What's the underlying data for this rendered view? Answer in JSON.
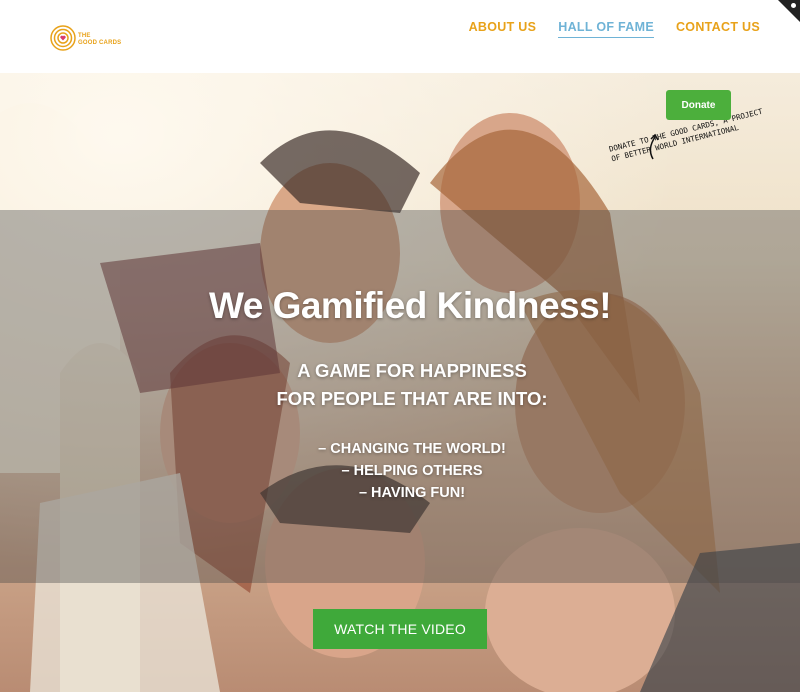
{
  "logo": {
    "line1": "THE",
    "line2": "GOOD CARDS",
    "icon": "concentric-rings-heart-icon"
  },
  "nav": {
    "items": [
      "ABOUT US",
      "HALL OF FAME",
      "CONTACT US"
    ],
    "active": "HALL OF FAME"
  },
  "donate": {
    "button_label": "Donate",
    "note": "Donate to the Good Cards, a project of Better World International"
  },
  "hero": {
    "headline": "We Gamified Kindness!",
    "sub_line1": "A GAME  FOR  HAPPINESS",
    "sub_line2": "FOR PEOPLE THAT ARE INTO:",
    "list": [
      "– CHANGING THE WORLD!",
      "– HELPING OTHERS",
      "– HAVING FUN!"
    ],
    "video_button": "WATCH THE VIDEO"
  },
  "colors": {
    "accent": "#e8a21a",
    "active_nav": "#6fb3d6",
    "button_green": "#3fa93a"
  }
}
